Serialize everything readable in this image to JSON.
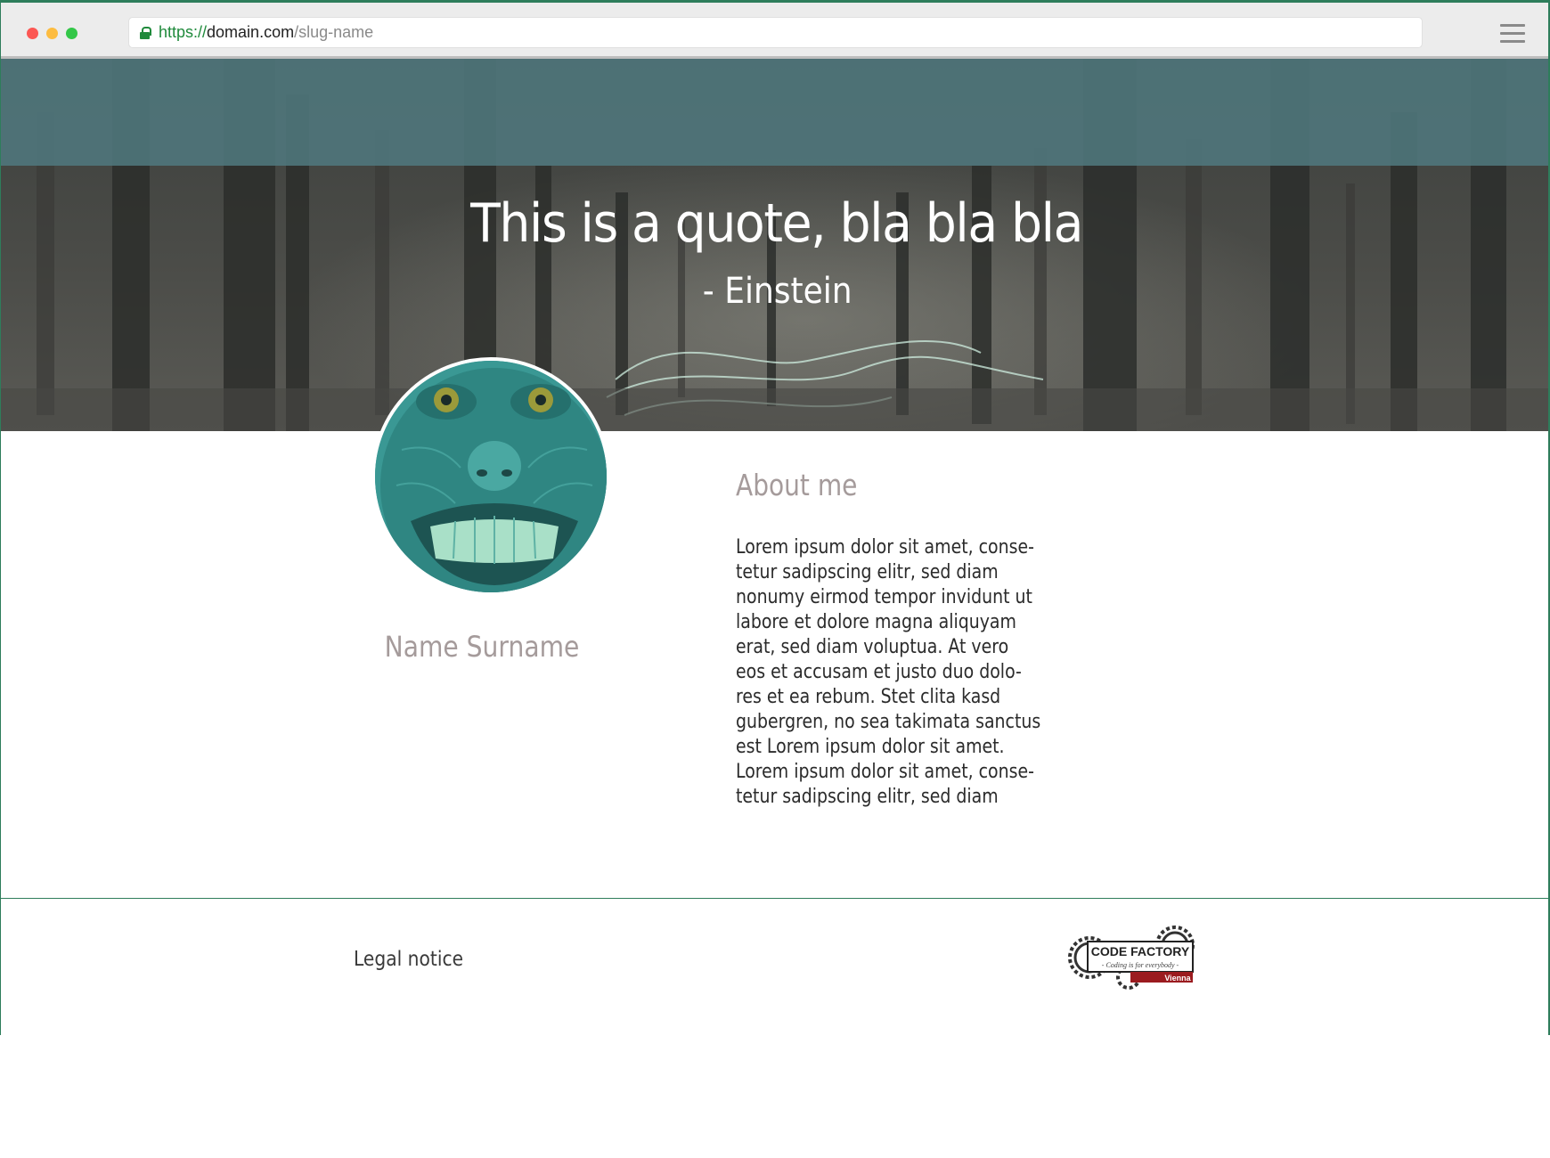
{
  "browser": {
    "url_scheme": "https://",
    "url_domain": "domain.com",
    "url_path": "/slug-name"
  },
  "hero": {
    "quote": "This is a quote, bla bla bla",
    "author": "- Einstein"
  },
  "profile": {
    "name": "Name Surname"
  },
  "about": {
    "title": "About me",
    "lines": [
      "Lorem ipsum dolor sit amet, conse-",
      "tetur sadipscing elitr, sed diam",
      "nonumy eirmod tempor invidunt ut",
      "labore et dolore magna aliquyam",
      "erat, sed diam voluptua. At vero",
      "eos et accusam et justo duo dolo-",
      "res et ea rebum. Stet clita kasd",
      "gubergren, no sea takimata sanctus",
      "est Lorem ipsum dolor sit amet.",
      "Lorem ipsum dolor sit amet, conse-",
      "tetur sadipscing elitr, sed diam"
    ]
  },
  "footer": {
    "legal_label": "Legal notice",
    "logo": {
      "title": "CODE FACTORY",
      "tagline": "- Coding is for everybody -",
      "city": "Vienna"
    }
  },
  "colors": {
    "window_border": "#2e7d5b",
    "hero_tint": "#50787d",
    "heading_gray": "#a59b9b",
    "avatar_teal": "#3a9894",
    "logo_red": "#9b1b1f"
  }
}
